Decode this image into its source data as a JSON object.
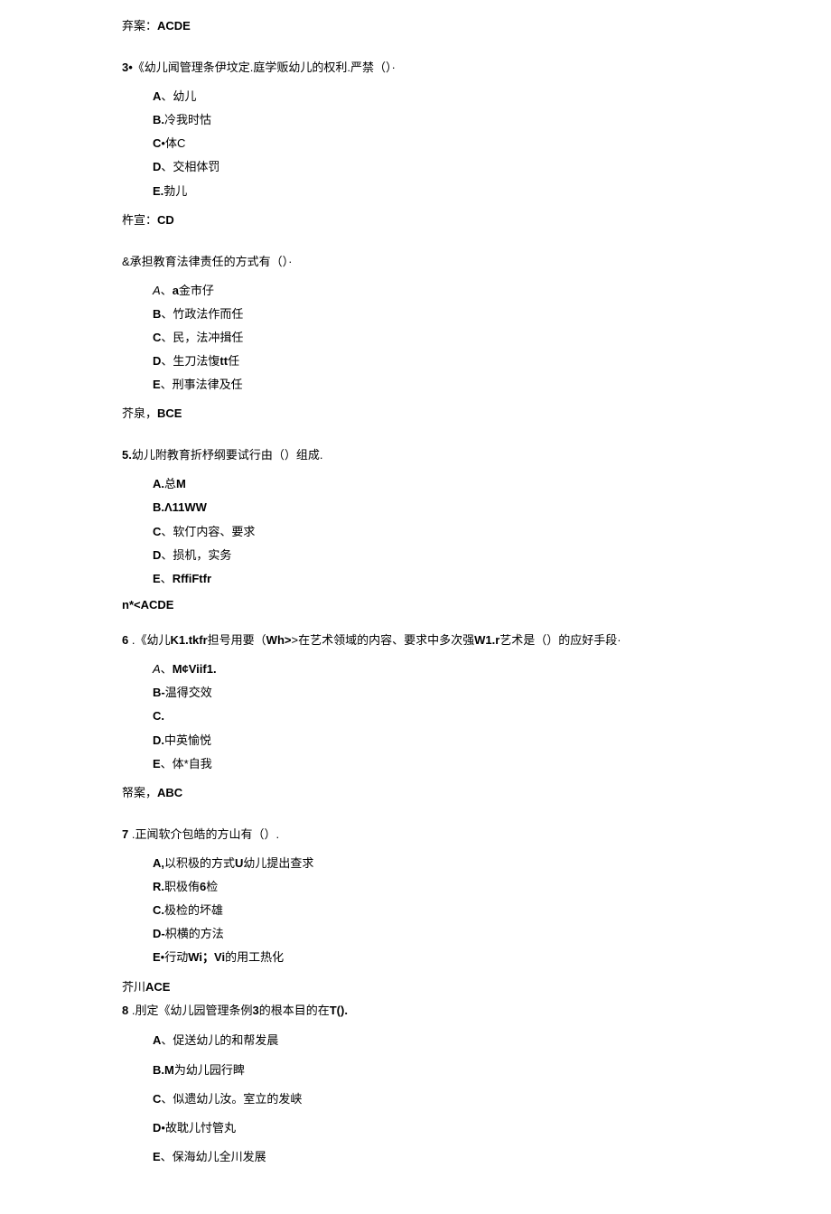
{
  "q2_answer_prefix": "弃案：",
  "q2_answer_val": "ACDE",
  "q3_num": "3•",
  "q3_body": "《幼儿闻管理条伊坟定.庭学贩幼儿的权利.严禁（）·",
  "q3_optA_pre": "A",
  "q3_optA": "、幼儿",
  "q3_optB_pre": "B.",
  "q3_optB": "冷我时怙",
  "q3_optC_pre": "C",
  "q3_optC": "•体C",
  "q3_optD_pre": "D",
  "q3_optD": "、交相体罚",
  "q3_optE_pre": "E.",
  "q3_optE": "勃儿",
  "q3_answer_prefix": "杵宣：",
  "q3_answer_val": "CD",
  "q4_num": "&",
  "q4_body": "承担教育法律责任的方式有（）·",
  "q4_optA_pre": "A",
  "q4_optA_sep": "、",
  "q4_optA_b": "a",
  "q4_optA_rest": "金市仔",
  "q4_optB_pre": "B",
  "q4_optB": "、竹政法作而任",
  "q4_optC_pre": "C",
  "q4_optC": "、民，法冲揖任",
  "q4_optD_pre": "D",
  "q4_optD_a": "、生刀法愎",
  "q4_optD_b": "tt",
  "q4_optD_c": "任",
  "q4_optE_pre": "E",
  "q4_optE": "、刑事法律及任",
  "q4_answer_prefix": "芥泉，",
  "q4_answer_val": "BCE",
  "q5_num": "5.",
  "q5_body": "幼儿附教育折杼纲要试行由（）组成.",
  "q5_optA_pre": "A.",
  "q5_optA_a": "总",
  "q5_optA_b": "M",
  "q5_optB": "B.Λ11WW",
  "q5_optC_pre": "C",
  "q5_optC": "、软仃内容、要求",
  "q5_optD_pre": "D",
  "q5_optD": "、损机，实务",
  "q5_optE_pre": "E",
  "q5_optE_sep": "、",
  "q5_optE_b": "RffiFtfr",
  "q5_answer": "n*<ACDE",
  "q6_num": "6",
  "q6_body_a": " .《幼儿",
  "q6_body_b": "K1.tkfr",
  "q6_body_c": "担号用要（",
  "q6_body_d": "Wh>",
  "q6_body_e": ">在艺术领域的内容、要求中多次强",
  "q6_body_f": "W1.r",
  "q6_body_g": "艺术是（）的应好手段·",
  "q6_optA_pre": "A",
  "q6_optA_sep": "、",
  "q6_optA_b": "M¢Viif1.",
  "q6_optB_pre": "B-",
  "q6_optB": "温得交效",
  "q6_optC": "C.",
  "q6_optD_pre": "D.",
  "q6_optD": "中英愉悦",
  "q6_optE_pre": "E",
  "q6_optE": "、体*自我",
  "q6_answer_prefix": "帑案，",
  "q6_answer_val": "ABC",
  "q7_num": "7",
  "q7_body": " .正闻软介包皓的方山有（）.",
  "q7_optA_pre": "A,",
  "q7_optA_a": "以积极的方式",
  "q7_optA_b": "U",
  "q7_optA_c": "幼儿提出查求",
  "q7_optB_pre": "R.",
  "q7_optB_a": "职极侑",
  "q7_optB_b": "6",
  "q7_optB_c": "检",
  "q7_optC_pre": "C.",
  "q7_optC": "极检的坏雄",
  "q7_optD_pre": "D-",
  "q7_optD": "枳横的方法",
  "q7_optE_pre": "E",
  "q7_optE_a": "•行动",
  "q7_optE_b": "Wi；Vi",
  "q7_optE_c": "的用工热化",
  "q7_answer_prefix": "芥川",
  "q7_answer_val": "ACE",
  "q8_num": "8",
  "q8_body_a": " .刖定《幼儿园管理条例",
  "q8_body_b": "3",
  "q8_body_c": "的根本目的在",
  "q8_body_d": "T().",
  "q8_optA_pre": "A",
  "q8_optA": "、促送幼儿的和帮发晨",
  "q8_optB_pre": "B.M",
  "q8_optB": "为幼儿园行睥",
  "q8_optC_pre": "C",
  "q8_optC": "、似遗幼儿汝。室立的发峡",
  "q8_optD_pre": "D",
  "q8_optD": "•故耽儿忖管丸",
  "q8_optE_pre": "E",
  "q8_optE": "、保海幼儿全川发展"
}
